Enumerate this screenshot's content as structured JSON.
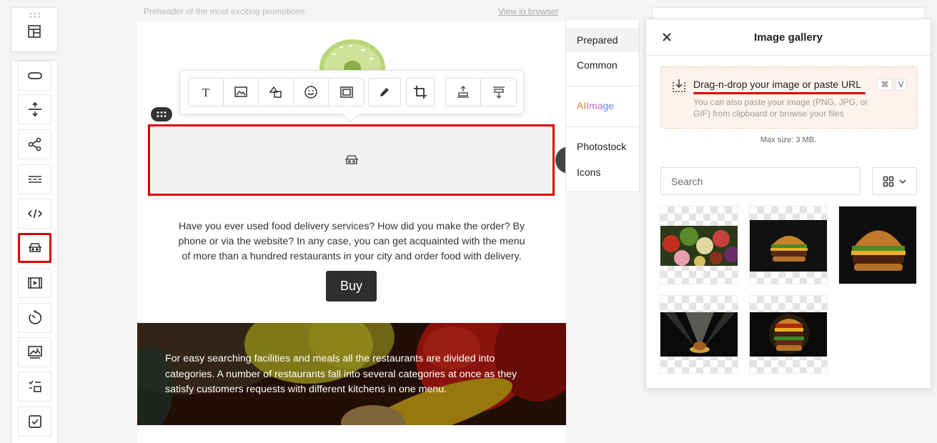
{
  "canvas": {
    "preheader": "Preheader of the most exciting promotions",
    "view_in_browser": "View in browser",
    "body_text": "Have you ever used food delivery services? How did you make the order? By phone or via the website? In any case, you can get acquainted with the menu of more than a hundred restaurants in your city and order food with delivery.",
    "buy_label": "Buy",
    "hero_text": "For easy searching facilities and meals all the restaurants are divided into categories. A number of restaurants fall into several categories at once as they satisfy customers requests with different kitchens in one menu."
  },
  "left_toolbar": {
    "items": [
      {
        "icon": "button-icon"
      },
      {
        "icon": "spacer-icon"
      },
      {
        "icon": "social-share-icon"
      },
      {
        "icon": "menu-icon"
      },
      {
        "icon": "html-code-icon"
      },
      {
        "icon": "amp-carousel-icon",
        "active": true
      },
      {
        "icon": "video-icon"
      },
      {
        "icon": "timer-icon"
      },
      {
        "icon": "banner-icon"
      },
      {
        "icon": "form-icon"
      },
      {
        "icon": "checkbox-icon"
      }
    ]
  },
  "categories": {
    "items": [
      "Prepared",
      "Common",
      "AI Image",
      "Photostock",
      "Icons"
    ],
    "ai_image_parts": [
      "AI ",
      "Ima",
      "ge"
    ]
  },
  "gallery": {
    "title": "Image gallery",
    "drop_title": "Drag-n-drop your image or paste URL",
    "shortcut_cmd": "⌘",
    "shortcut_key": "V",
    "drop_hint": "You can also paste your image (PNG, JPG, or GIF) from clipboard or browse your files",
    "max_size": "Max size: 3 MB.",
    "search_placeholder": "Search"
  },
  "colors": {
    "highlight": "#d90000",
    "button_dark": "#2f2f2f",
    "drop_zone_bg": "#fdf3ec"
  }
}
